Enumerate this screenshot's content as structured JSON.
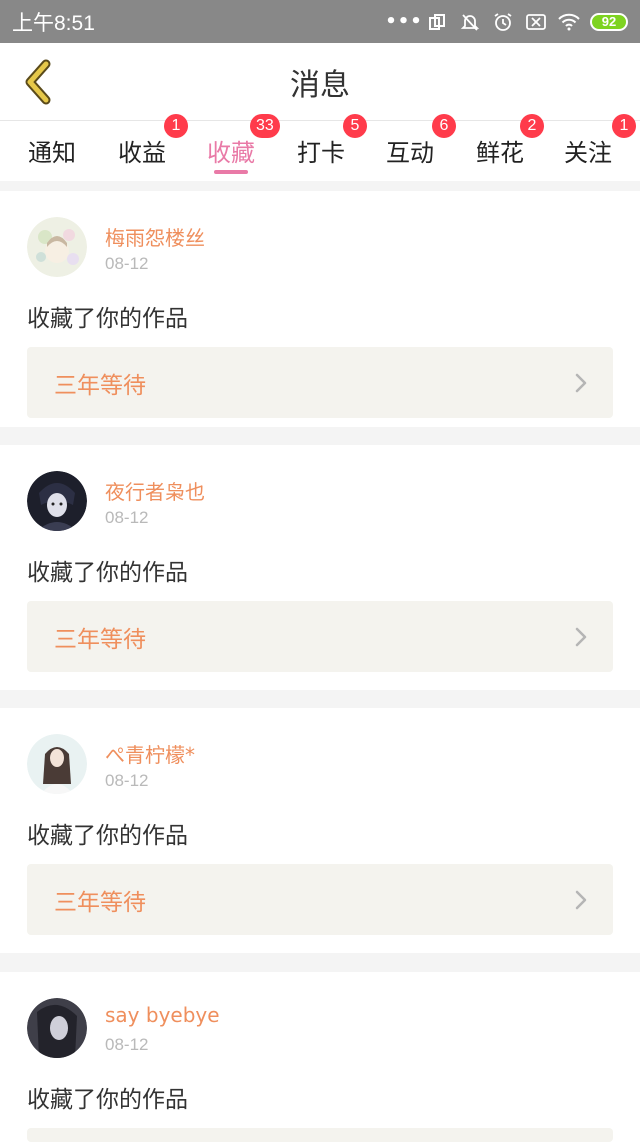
{
  "status_bar": {
    "time": "上午8:51",
    "battery": "92",
    "icons": [
      "more-dots-icon",
      "screen-cast-icon",
      "mute-icon",
      "alarm-icon",
      "sim-off-icon",
      "wifi-icon",
      "battery-icon"
    ]
  },
  "header": {
    "title": "消息",
    "back_icon": "chevron-left-icon",
    "accent_color": "#e6c84a"
  },
  "tabs": [
    {
      "label": "通知",
      "badge": ""
    },
    {
      "label": "收益",
      "badge": "1"
    },
    {
      "label": "收藏",
      "badge": "33",
      "active": true
    },
    {
      "label": "打卡",
      "badge": "5"
    },
    {
      "label": "互动",
      "badge": "6"
    },
    {
      "label": "鲜花",
      "badge": "2"
    },
    {
      "label": "关注",
      "badge": "1"
    }
  ],
  "colors": {
    "active_tab": "#e97aa7",
    "badge": "#ff3b4b",
    "username": "#ef8f5d"
  },
  "messages": [
    {
      "username": "梅雨怨楼丝",
      "date": "08-12",
      "action": "收藏了你的作品",
      "work_title": "三年等待"
    },
    {
      "username": "夜行者枭也",
      "date": "08-12",
      "action": "收藏了你的作品",
      "work_title": "三年等待"
    },
    {
      "username": "ぺ青柠檬*",
      "date": "08-12",
      "action": "收藏了你的作品",
      "work_title": "三年等待"
    },
    {
      "username": "say byebye",
      "date": "08-12",
      "action": "收藏了你的作品",
      "work_title": ""
    }
  ]
}
